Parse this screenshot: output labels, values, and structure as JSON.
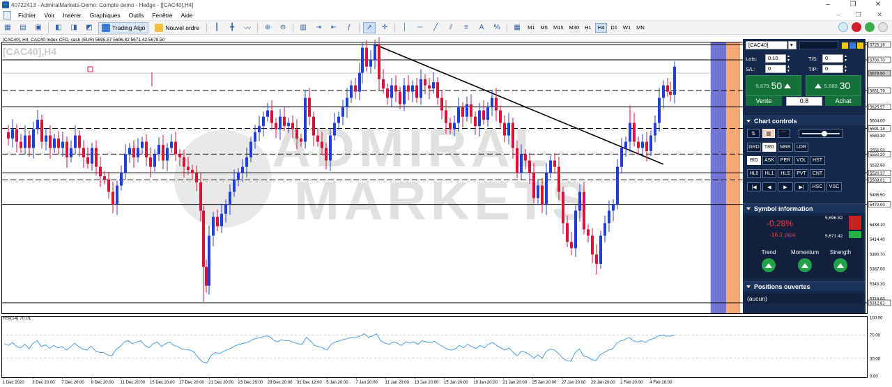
{
  "window": {
    "title": "40722413 - AdmiralMarkets-Demo: Compte demo - Hedge - [[CAC40],H4]"
  },
  "menu": {
    "items": [
      "Fichier",
      "Voir",
      "Insérer",
      "Graphiques",
      "Outils",
      "Fenêtre",
      "Aide"
    ]
  },
  "toolbar": {
    "trading_algo": "Trading Algo",
    "new_order": "Nouvel ordre",
    "timeframes": [
      "M1",
      "M5",
      "M15",
      "M30",
      "H1",
      "H4",
      "D1",
      "W1",
      "MN"
    ],
    "active_timeframe": "H4"
  },
  "chart": {
    "header": "[CAC40], H4: CAC40 Index CFD, cash (EUR)  5695.57 5696.82 5671.42 5679.50",
    "symbol_overlay": "[CAC40],H4",
    "rsi_label": "RSI(14) 70.01",
    "watermark_line1": "ADMIRAL",
    "watermark_line2": "MARKETS",
    "price_labels": [
      "5725.16",
      "5700.70",
      "5679.50",
      "5651.79",
      "5625.57",
      "5604.00",
      "5591.18",
      "5580.30",
      "5556.50",
      "5550.20",
      "5532.90",
      "5520.37",
      "5509.01",
      "5485.50",
      "5470.00",
      "5438.10",
      "5414.40",
      "5390.70",
      "5367.00",
      "5343.30",
      "5319.60",
      "5312.81"
    ],
    "rsi_labels": [
      "100.00",
      "70.00",
      "30.00",
      "0.00"
    ],
    "date_labels": [
      "1 Dec 2020",
      "3 Dec 20:00",
      "7 Dec 20:00",
      "9 Dec 20:00",
      "11 Dec 20:00",
      "15 Dec 20:00",
      "17 Dec 20:00",
      "21 Dec 20:00",
      "23 Dec 20:00",
      "29 Dec 20:00",
      "31 Dec 12:00",
      "5 Jan 20:00",
      "7 Jan 20:00",
      "11 Jan 20:00",
      "13 Jan 20:00",
      "15 Jan 20:00",
      "19 Jan 20:00",
      "21 Jan 20:00",
      "25 Jan 20:00",
      "27 Jan 20:00",
      "29 Jan 20:00",
      "2 Feb 20:00",
      "4 Feb 20:00"
    ],
    "colors": {
      "bull": "#1f3fd8",
      "bear": "#d6153a",
      "rsi": "#4a9fe0",
      "band_blue": "#6b6fd1",
      "band_orange": "#f5a26f"
    }
  },
  "panel": {
    "symbol": "[CAC40]",
    "lots_label": "Lots:",
    "lots_value": "0.10",
    "sl_label": "S/L:",
    "sl_value": "0",
    "ts_label": "T/S:",
    "ts_value": "0",
    "tp_label": "T/P:",
    "tp_value": "0",
    "sell_small": "5,679.",
    "sell_big": "50",
    "buy_small": "5,680.",
    "buy_big": "30",
    "sell_label": "Vente",
    "buy_label": "Achat",
    "spread": "0.8",
    "chart_controls": "Chart controls",
    "row2": [
      "GRD",
      "TRD",
      "MRK",
      "LDR"
    ],
    "row3": [
      "BID",
      "ASK",
      "PER",
      "VOL",
      "HST"
    ],
    "row4": [
      "HL0",
      "HL1",
      "HLS",
      "PVT",
      "CNT"
    ],
    "row5": [
      "|◀",
      "◀",
      "▶",
      "▶|",
      "HSC",
      "VSC"
    ],
    "symbol_info": "Symbol information",
    "change_pct": "-0.28%",
    "change_pips": "-16.1 pips",
    "high": "5,696.82",
    "low": "5,671.42",
    "trend": "Trend",
    "momentum": "Momentum",
    "strength": "Strength",
    "open_positions": "Positions ouvertes",
    "none": "(aucun)"
  }
}
